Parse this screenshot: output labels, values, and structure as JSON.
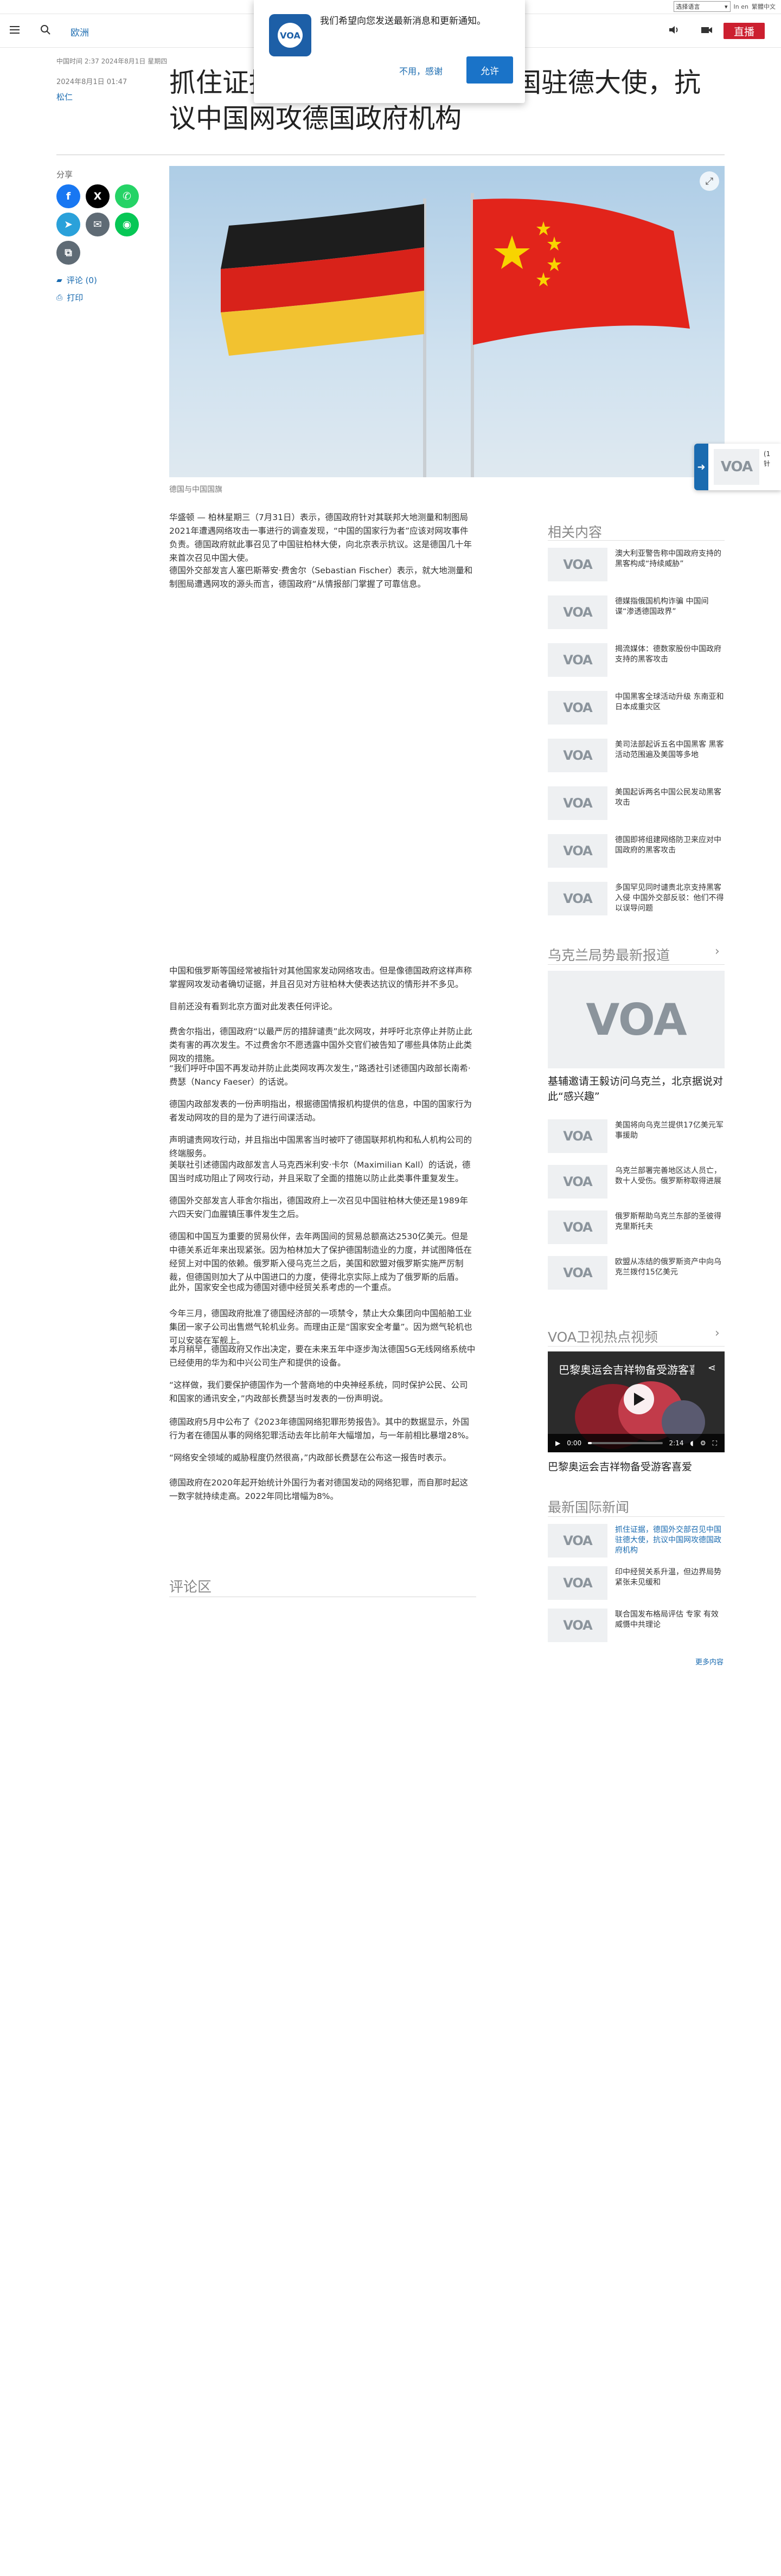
{
  "utility": {
    "language_select": "选择语言",
    "link_en": "In en",
    "link_trad": "繁體中文"
  },
  "header": {
    "section": "欧洲",
    "live_label": "直播"
  },
  "notification": {
    "message": "我们希望向您发送最新消息和更新通知。",
    "decline_label": "不用，感谢",
    "accept_label": "允许"
  },
  "article": {
    "meta_line": "中国时间 2:37 2024年8月1日 星期四",
    "date": "2024年8月1日 01:47",
    "author": "松仁",
    "headline": "抓住证据，德国外交部召见中国驻德大使，抗议中国网攻德国政府机构",
    "share_label": "分享",
    "comments_link": "评论 (0)",
    "print_link": "打印",
    "image_caption": "德国与中国国旗",
    "paragraphs_top": [
      "华盛顿 — 柏林星期三（7月31日）表示，德国政府针对其联邦大地测量和制图局2021年遭遇网络攻击一事进行的调查发现，“中国的国家行为者”应该对网攻事件负责。德国政府就此事召见了中国驻柏林大使，向北京表示抗议。这是德国几十年来首次召见中国大使。",
      "德国外交部发言人塞巴斯蒂安·费舍尔（Sebastian Fischer）表示，就大地测量和制图局遭遇网攻的源头而言，德国政府“从情报部门掌握了可靠信息。"
    ],
    "paragraphs_bottom": [
      "中国和俄罗斯等国经常被指针对其他国家发动网络攻击。但是像德国政府这样声称掌握网攻发动者确切证据，并且召见对方驻柏林大使表达抗议的情形并不多见。",
      "目前还没有看到北京方面对此发表任何评论。",
      "费舍尔指出，德国政府“以最严厉的措辞谴责”此次网攻，并呼吁北京停止并防止此类有害的再次发生。不过费舍尔不愿透露中国外交官们被告知了哪些具体防止此类网攻的措施。",
      "“我们呼吁中国不再发动并防止此类网攻再次发生，”路透社引述德国内政部长南希·费瑟（Nancy Faeser）的话说。",
      "德国内政部发表的一份声明指出，根据德国情报机构提供的信息，中国的国家行为者发动网攻的目的是为了进行间谍活动。",
      "声明谴责网攻行动，并且指出中国黑客当时被吓了德国联邦机构和私人机构公司的终端服务。",
      "美联社引述德国内政部发言人马克西米利安·卡尔（Maximilian Kall）的话说，德国当时成功阻止了网攻行动，并且采取了全面的措施以防止此类事件重复发生。",
      "德国外交部发言人菲舍尔指出，德国政府上一次召见中国驻柏林大使还是1989年六四天安门血腥镇压事件发生之后。",
      "德国和中国互为重要的贸易伙伴，去年两国间的贸易总额高达2530亿美元。但是中德关系近年来出现紧张。因为柏林加大了保护德国制造业的力度，并试图降低在经贸上对中国的依赖。俄罗斯入侵乌克兰之后，美国和欧盟对俄罗斯实施严厉制裁，但德国则加大了从中国进口的力度，使得北京实际上成为了俄罗斯的后盾。",
      "此外，国家安全也成为德国对德中经贸关系考虑的一个重点。",
      "今年三月，德国政府批准了德国经济部的一项禁令，禁止大众集团向中国船舶工业集团一家子公司出售燃气轮机业务。而理由正是“国家安全考量”。因为燃气轮机也可以安装在军舰上。",
      "本月稍早，德国政府又作出决定，要在未来五年中逐步淘汰德国5G无线网络系统中已经使用的华为和中兴公司生产和提供的设备。",
      "“这样做，我们要保护德国作为一个营商地的中央神经系统，同时保护公民、公司和国家的通讯安全，”内政部长费瑟当时发表的一份声明说。",
      "德国政府5月中公布了《2023年德国网络犯罪形势报告》。其中的数据显示，外国行为者在德国从事的网络犯罪活动去年比前年大幅增加，与一年前相比暴增28%。",
      "“网络安全领域的威胁程度仍然很高，”内政部长费瑟在公布这一报告时表示。",
      "德国政府在2020年起开始统计外国行为者对德国发动的网络犯罪，而自那时起这一数字就持续走高。2022年同比增幅为8%。"
    ],
    "comments_heading": "评论区"
  },
  "float_widget": {
    "text_line1": "(1",
    "text_line2": "针"
  },
  "related": {
    "heading": "相关内容",
    "items": [
      {
        "title": "澳大利亚警告称中国政府支持的黑客构成“持续威胁”"
      },
      {
        "title": "德媒指俄国机构诈骗 中国间谍“渗透德国政界”"
      },
      {
        "title": "揭流媒体：德数家股份中国政府支持的黑客攻击"
      },
      {
        "title": "中国黑客全球活动升级 东南亚和日本成重灾区"
      },
      {
        "title": "美司法部起诉五名中国黑客 黑客活动范围遍及美国等多地"
      },
      {
        "title": "美国起诉两名中国公民发动黑客攻击"
      },
      {
        "title": "德国即将组建网络防卫来应对中国政府的黑客攻击"
      },
      {
        "title": "多国罕见同时谴责北京支持黑客入侵 中国外交部反驳：他们不得以误导问题"
      }
    ]
  },
  "ukraine": {
    "heading": "乌克兰局势最新报道",
    "feature_title": "基辅邀请王毅访问乌克兰，北京据说对此“感兴趣”",
    "items": [
      {
        "title": "美国将向乌克兰提供17亿美元军事援助"
      },
      {
        "title": "乌克兰部署完善地区达人员亡，数十人受伤。俄罗斯称取得进展"
      },
      {
        "title": "俄罗斯帮助乌克兰东部的圣彼得克里斯托夫"
      },
      {
        "title": "欧盟从冻结的俄罗斯资产中向乌克兰拨付15亿美元"
      }
    ]
  },
  "video": {
    "heading": "VOA卫视热点视频",
    "title": "巴黎奥运会吉祥物备受游客喜爱",
    "time": "0:00",
    "duration": "2:14",
    "progress": 0.05,
    "caption": "巴黎奥运会吉祥物备受游客喜爱"
  },
  "intl": {
    "heading": "最新国际新闻",
    "items": [
      {
        "title": "抓住证据，德国外交部召见中国驻德大使，抗议中国网攻德国政府机构",
        "active": true
      },
      {
        "title": "印中经贸关系升温，但边界局势紧张未见缓和"
      },
      {
        "title": "联合国发布格局评估 专家 有效威慑中共理论"
      }
    ],
    "more_link": "更多内容"
  },
  "colors": {
    "brand_blue": "#1a6bb0",
    "live_red": "#cc1f2f",
    "accept_blue": "#1a73c8"
  }
}
